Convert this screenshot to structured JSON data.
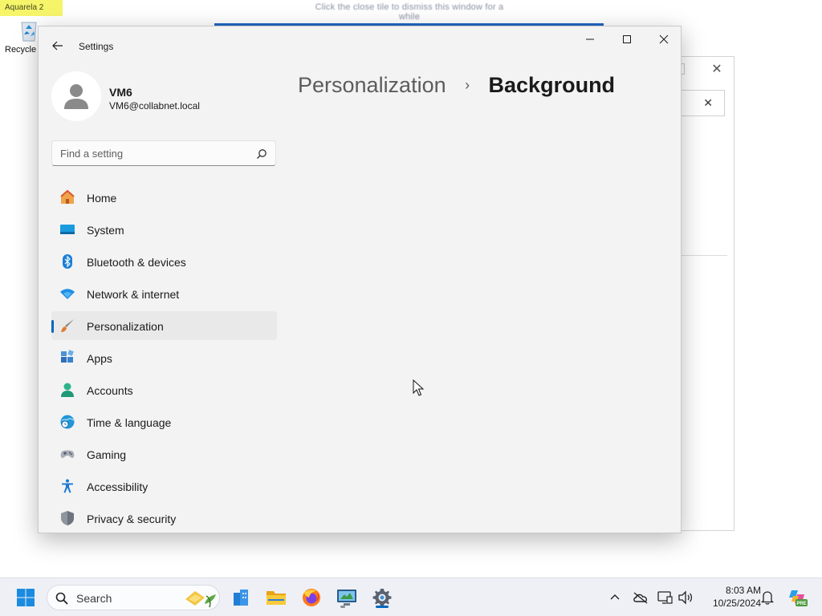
{
  "desktop": {
    "top_hint": "Click the close tile to dismiss this window for a while",
    "badge": "Aquarela 2",
    "recycle_label": "Recycle"
  },
  "window": {
    "title": "Settings",
    "breadcrumb_parent": "Personalization",
    "breadcrumb_separator": "›",
    "breadcrumb_current": "Background"
  },
  "profile": {
    "name": "VM6",
    "email": "VM6@collabnet.local"
  },
  "search": {
    "placeholder": "Find a setting"
  },
  "nav": {
    "items": [
      {
        "label": "Home",
        "icon": "home-icon"
      },
      {
        "label": "System",
        "icon": "system-icon"
      },
      {
        "label": "Bluetooth & devices",
        "icon": "bluetooth-icon"
      },
      {
        "label": "Network & internet",
        "icon": "wifi-icon"
      },
      {
        "label": "Personalization",
        "icon": "brush-icon",
        "active": true
      },
      {
        "label": "Apps",
        "icon": "apps-icon"
      },
      {
        "label": "Accounts",
        "icon": "person-icon"
      },
      {
        "label": "Time & language",
        "icon": "globe-clock-icon"
      },
      {
        "label": "Gaming",
        "icon": "gamepad-icon"
      },
      {
        "label": "Accessibility",
        "icon": "accessibility-icon"
      },
      {
        "label": "Privacy & security",
        "icon": "shield-icon"
      }
    ]
  },
  "taskbar": {
    "search_label": "Search",
    "time": "8:03 AM",
    "date": "10/25/2024",
    "copilot_badge": "PRE"
  },
  "colors": {
    "accent": "#0067c0",
    "window_bg": "#f3f3f3",
    "nav_active_bg": "#e9e9e9"
  }
}
